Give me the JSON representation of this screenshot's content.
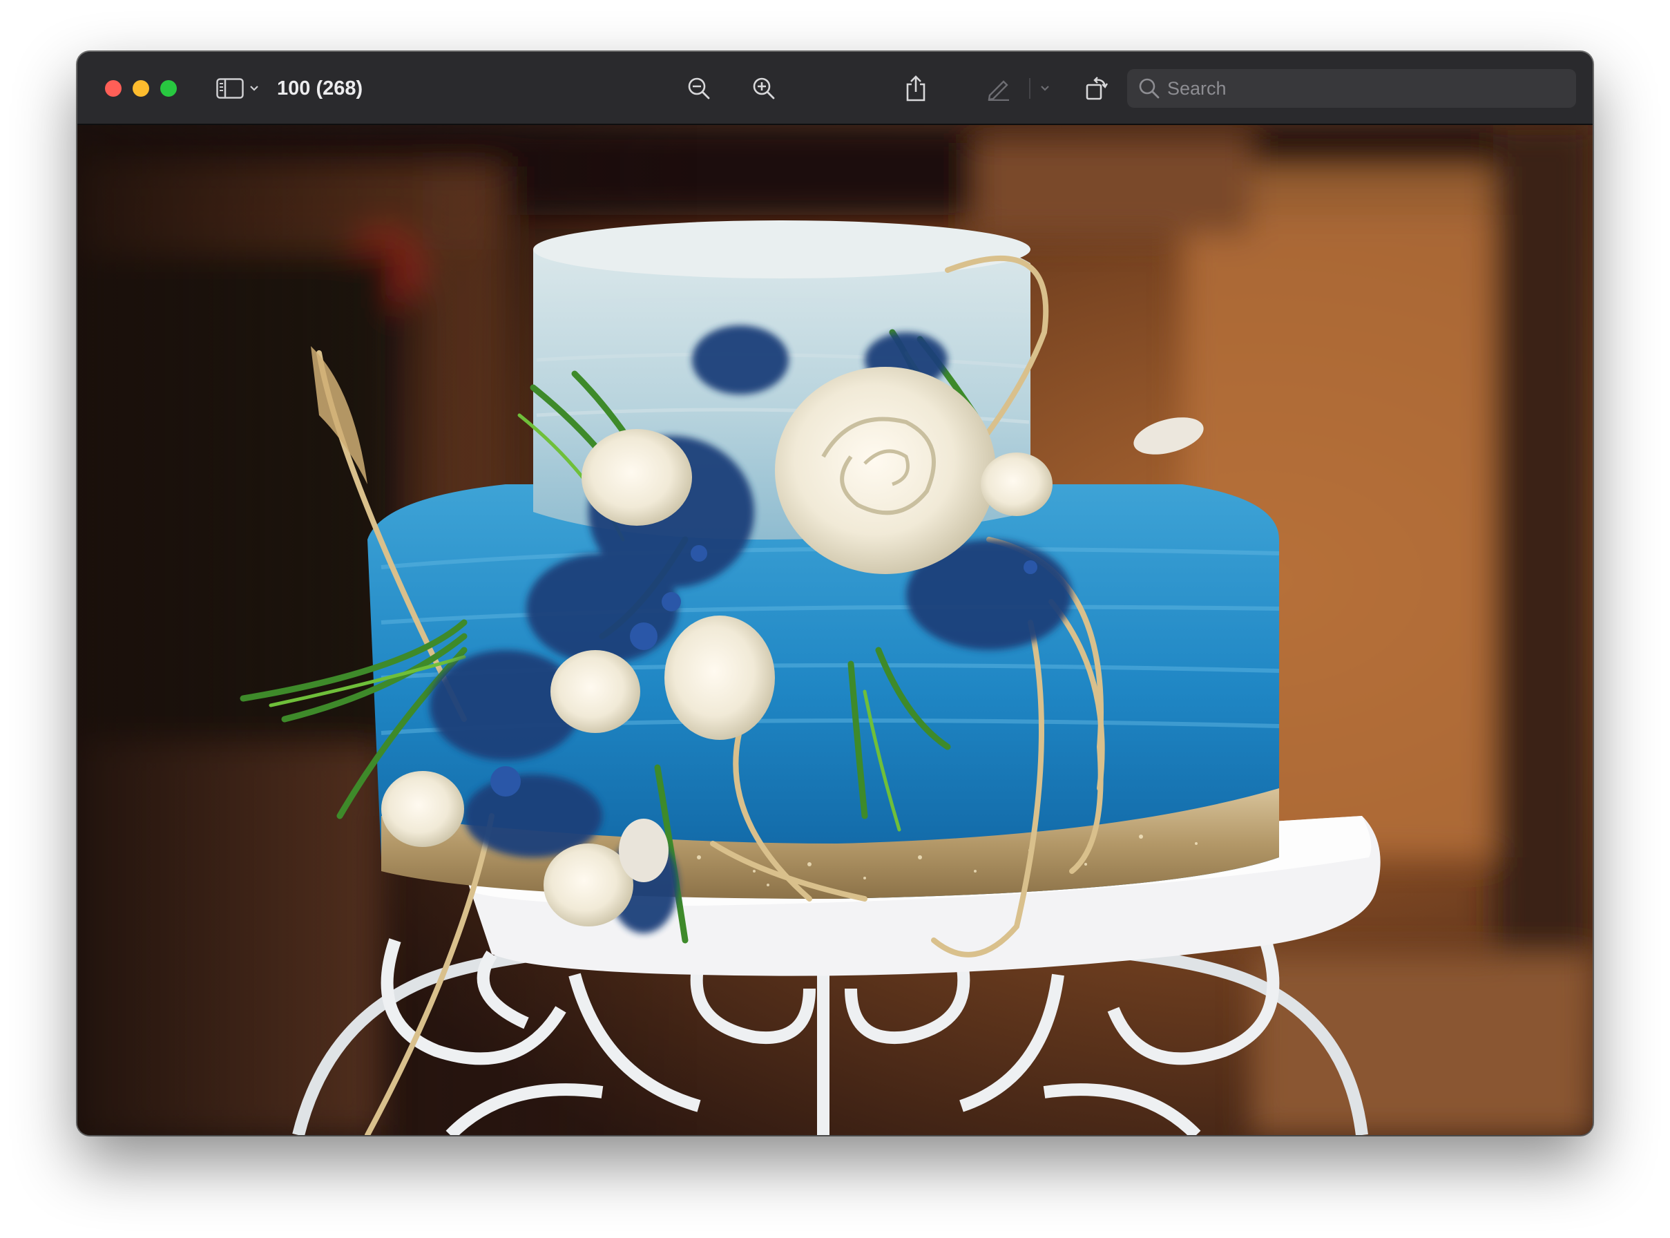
{
  "window": {
    "title": "100 (268)"
  },
  "toolbar": {
    "sidebar_icon": "sidebar-icon",
    "zoom_out_icon": "zoom-out-icon",
    "zoom_in_icon": "zoom-in-icon",
    "share_icon": "share-icon",
    "highlight_icon": "pencil-icon",
    "rotate_icon": "rotate-icon",
    "markup_icon": "markup-icon"
  },
  "search": {
    "placeholder": "Search",
    "value": ""
  },
  "colors": {
    "close": "#ff5f57",
    "minimize": "#febc2e",
    "maximize": "#28c840",
    "titlebar": "#2a2a2d"
  }
}
